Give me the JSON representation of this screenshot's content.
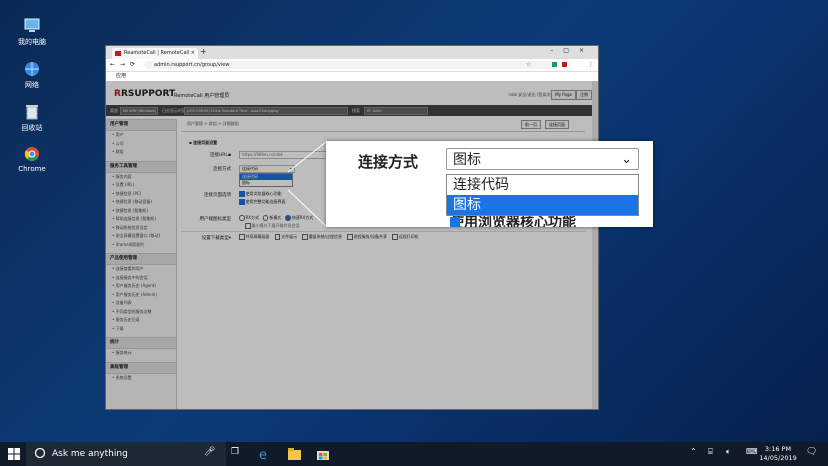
{
  "desktop": {
    "icons": [
      {
        "label": "我的电脑"
      },
      {
        "label": "网络"
      },
      {
        "label": "回收站"
      },
      {
        "label": "Chrome"
      }
    ]
  },
  "browser": {
    "tab_title": "ReamoteCall | RemoteCall",
    "url": "admin.rsupport.cn/group/view",
    "bookmark": "应用"
  },
  "header": {
    "brand": "RSUPPORT",
    "app_title": "RemoteCall 用户管理员",
    "user_info": "rsbk 安全/退出 (登录次数)",
    "mypage": "My Page",
    "logout": "注销"
  },
  "filterbar": {
    "label1": "渠道",
    "value1": "MS-WIN (Windows)",
    "label2": "日志显示时区",
    "value2": "(UTC+08:00) China Standard Time - Asia/Chongqing",
    "label3": "搜索",
    "value3": "RC Allim"
  },
  "sidebar": {
    "sections": [
      {
        "title": "用户管理",
        "items": [
          "用户",
          "公司",
          "群组"
        ]
      },
      {
        "title": "服务工具管理",
        "items": [
          "服务内容",
          "设置 (IRL)",
          "快捷信息 (PC)",
          "快捷信息 (移动设备)",
          "快捷信息 (智能机)",
          "帮助连接信息 (智能机)",
          "移动系统信息设定",
          "安全屏幕设置窗口 (移动)",
          "iframe调用图片"
        ]
      },
      {
        "title": "产品使用管理",
        "items": [
          "连接查看的用户",
          "连接服务中的会话",
          "用户服务历史 (Agent)",
          "用户服务历史 (Admin)",
          "设备列表",
          "不同类型的服务次数",
          "服务历史记录",
          "下载"
        ]
      },
      {
        "title": "统计",
        "items": [
          "服务统计"
        ]
      },
      {
        "title": "高级管理",
        "items": [
          "系统设置"
        ]
      }
    ]
  },
  "main": {
    "breadcrumb": "用户管理 > 群组 > 详细群组",
    "btn_prev": "前一页",
    "btn_save": "连接页面",
    "section_title": "连接页面设置",
    "url_label": "连接URL",
    "url_value": "https://906m.rs/rsbk",
    "method_label": "连接方式",
    "method_value": "连接代码",
    "method_options": [
      "连接代码",
      "图标"
    ],
    "screen_label": "连接页面选项",
    "screen_opt1": "使用浏览器核心功能",
    "screen_opt2": "使用完整功能连接界面",
    "display_label": "用户端图标类型",
    "display_opts": [
      "RX方式",
      "新模式",
      "快速RX方式"
    ],
    "display_sub": "最小模式下展开操作员会话",
    "items_label": "设置下载类型",
    "items_opts": [
      "共享屏幕画面",
      "文件展示",
      "重复系统/过程信息",
      "进程服务/设备共享",
      "远程打印机"
    ]
  },
  "zoom": {
    "label": "连接方式",
    "selected": "图标",
    "options": [
      "连接代码",
      "图标"
    ],
    "under_text": "使用浏览器核心功能"
  },
  "taskbar": {
    "search_placeholder": "Ask me anything",
    "time": "3:16 PM",
    "date": "14/05/2019"
  },
  "colors": {
    "accent": "#1a73e8",
    "brand_red": "#c2191e",
    "taskbar": "#111a28"
  }
}
